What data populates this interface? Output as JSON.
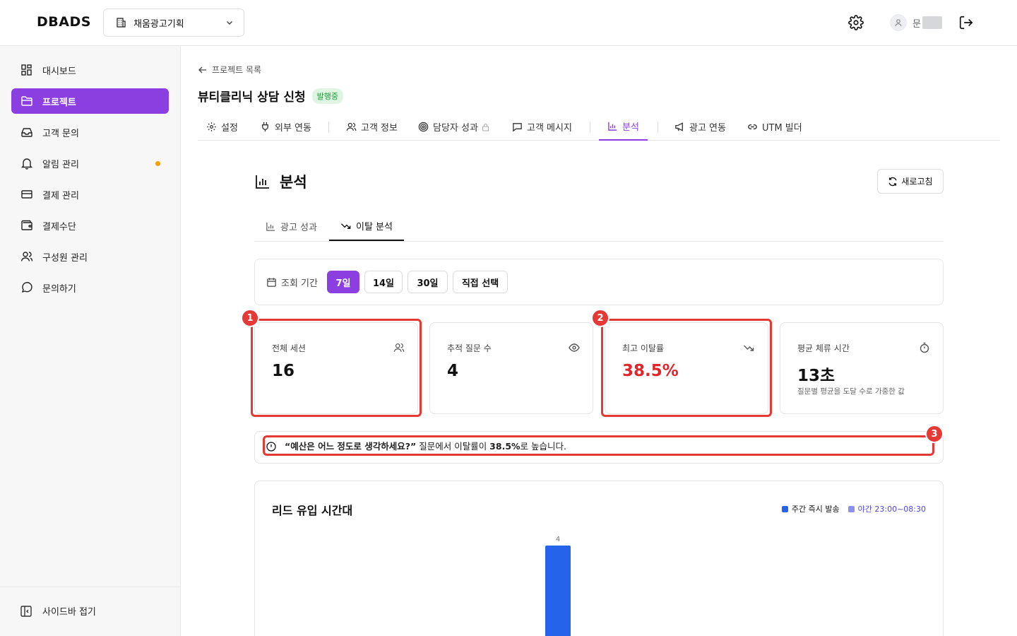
{
  "app": {
    "logo": "DBADS"
  },
  "header": {
    "project_select": "채움광고기획",
    "user_name": "문"
  },
  "sidebar": {
    "items": [
      {
        "label": "대시보드",
        "icon": "dashboard-icon"
      },
      {
        "label": "프로젝트",
        "icon": "folder-icon",
        "active": true
      },
      {
        "label": "고객 문의",
        "icon": "inbox-icon"
      },
      {
        "label": "알림 관리",
        "icon": "bell-icon",
        "dot": true
      },
      {
        "label": "결제 관리",
        "icon": "credit-card-icon"
      },
      {
        "label": "결제수단",
        "icon": "wallet-icon"
      },
      {
        "label": "구성원 관리",
        "icon": "users-icon"
      },
      {
        "label": "문의하기",
        "icon": "chat-icon"
      }
    ],
    "collapse_label": "사이드바 접기"
  },
  "breadcrumb": {
    "back_label": "프로젝트 목록"
  },
  "project": {
    "title": "뷰티클리닉 상담 신청",
    "status": "발행중"
  },
  "tabs": [
    {
      "label": "설정"
    },
    {
      "label": "외부 연동"
    },
    {
      "label": "고객 정보"
    },
    {
      "label": "담당자 성과"
    },
    {
      "label": "고객 메시지"
    },
    {
      "label": "분석"
    },
    {
      "label": "광고 연동"
    },
    {
      "label": "UTM 빌더"
    }
  ],
  "section": {
    "title": "분석",
    "refresh_label": "새로고침"
  },
  "subtabs": [
    {
      "label": "광고 성과"
    },
    {
      "label": "이탈 분석"
    }
  ],
  "period": {
    "label": "조회 기간",
    "options": [
      "7일",
      "14일",
      "30일",
      "직접 선택"
    ],
    "selected": "7일"
  },
  "cards": [
    {
      "title": "전체 세션",
      "value": "16",
      "icon": "users-icon"
    },
    {
      "title": "추적 질문 수",
      "value": "4",
      "icon": "eye-icon"
    },
    {
      "title": "최고 이탈률",
      "value": "38.5%",
      "icon": "trending-down-icon"
    },
    {
      "title": "평균 체류 시간",
      "value": "13초",
      "sub": "질문별 평균을 도달 수로 가중한 값",
      "icon": "timer-icon"
    }
  ],
  "annotations": [
    "1",
    "2",
    "3"
  ],
  "insight": {
    "question": "“예산은 어느 정도로 생각하세요?”",
    "mid": " 질문에서 이탈률이 ",
    "rate": "38.5%",
    "end": "로 높습니다."
  },
  "chart_data": {
    "type": "bar",
    "title": "리드 유입 시간대",
    "series": [
      {
        "name": "주간 즉시 발송",
        "color": "#2563eb"
      },
      {
        "name": "야간 23:00~08:30",
        "color": "#8b8ff0"
      }
    ],
    "visible_bars": [
      {
        "value": 4,
        "label": "4"
      }
    ]
  },
  "colors": {
    "accent": "#8b3fe0",
    "danger": "#e0262a",
    "bar_day": "#2563eb",
    "bar_night": "#8b8ff0"
  }
}
